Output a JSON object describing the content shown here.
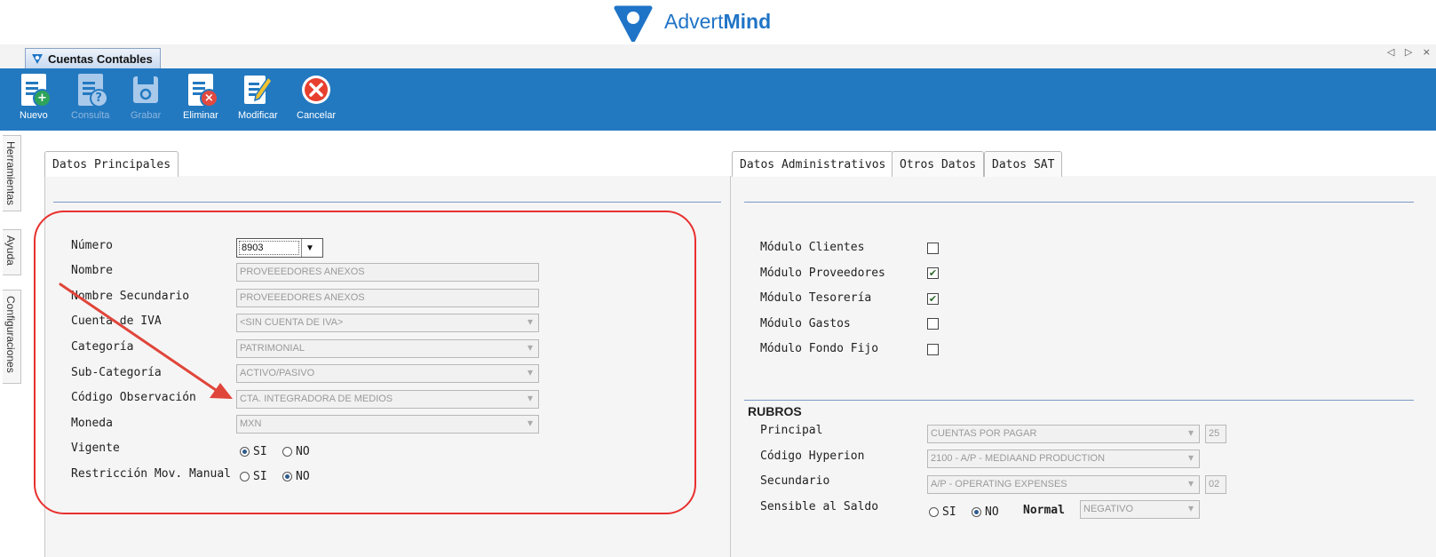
{
  "brand": {
    "name_prefix": "Advert",
    "name_bold": "Mind",
    "logo_color": "#1f74c7"
  },
  "document_tab": {
    "title": "Cuentas Contables",
    "nav": "◁ ▷ ×"
  },
  "toolbar": {
    "background": "#2379c0",
    "buttons": [
      {
        "label": "Nuevo",
        "icon": "new-document-icon",
        "enabled": true
      },
      {
        "label": "Consulta",
        "icon": "query-document-icon",
        "enabled": false
      },
      {
        "label": "Grabar",
        "icon": "save-icon",
        "enabled": false
      },
      {
        "label": "Eliminar",
        "icon": "delete-document-icon",
        "enabled": true
      },
      {
        "label": "Modificar",
        "icon": "edit-document-icon",
        "enabled": true
      },
      {
        "label": "Cancelar",
        "icon": "cancel-icon",
        "enabled": true
      }
    ]
  },
  "side_tabs": [
    "Herramientas",
    "Ayuda",
    "Configuraciones"
  ],
  "left_panel": {
    "tab": "Datos Principales",
    "fields": {
      "numero": {
        "label": "Número",
        "value": "8903"
      },
      "nombre": {
        "label": "Nombre",
        "value": "PROVEEEDORES ANEXOS"
      },
      "nombre_secundario": {
        "label": "Nombre Secundario",
        "value": "PROVEEEDORES ANEXOS"
      },
      "cuenta_iva": {
        "label": "Cuenta de IVA",
        "value": "<SIN CUENTA DE IVA>"
      },
      "categoria": {
        "label": "Categoría",
        "value": "PATRIMONIAL"
      },
      "sub_categoria": {
        "label": "Sub-Categoría",
        "value": "ACTIVO/PASIVO"
      },
      "codigo_observacion": {
        "label": "Código Observación",
        "value": "CTA. INTEGRADORA DE MEDIOS"
      },
      "moneda": {
        "label": "Moneda",
        "value": "MXN"
      },
      "vigente": {
        "label": "Vigente",
        "options": [
          "SI",
          "NO"
        ],
        "selected": "SI"
      },
      "restriccion": {
        "label": "Restricción Mov. Manual",
        "options": [
          "SI",
          "NO"
        ],
        "selected": "NO"
      }
    },
    "highlight_color": "#e8302e"
  },
  "right_panel": {
    "tabs": [
      "Datos Administrativos",
      "Otros Datos",
      "Datos SAT"
    ],
    "modules": [
      {
        "label": "Módulo Clientes",
        "checked": false
      },
      {
        "label": "Módulo Proveedores",
        "checked": true
      },
      {
        "label": "Módulo Tesorería",
        "checked": true
      },
      {
        "label": "Módulo Gastos",
        "checked": false
      },
      {
        "label": "Módulo Fondo Fijo",
        "checked": false
      }
    ],
    "rubros": {
      "title": "RUBROS",
      "principal": {
        "label": "Principal",
        "value": "CUENTAS POR PAGAR",
        "code": "25"
      },
      "hyperion": {
        "label": "Código Hyperion",
        "value": "2100 - A/P - MEDIAAND PRODUCTION"
      },
      "secundario": {
        "label": "Secundario",
        "value": "A/P - OPERATING EXPENSES",
        "code": "02"
      },
      "sensible": {
        "label": "Sensible al Saldo",
        "options": [
          "SI",
          "NO"
        ],
        "selected": "NO",
        "normal_label": "Normal",
        "normal_value": "NEGATIVO"
      }
    }
  }
}
